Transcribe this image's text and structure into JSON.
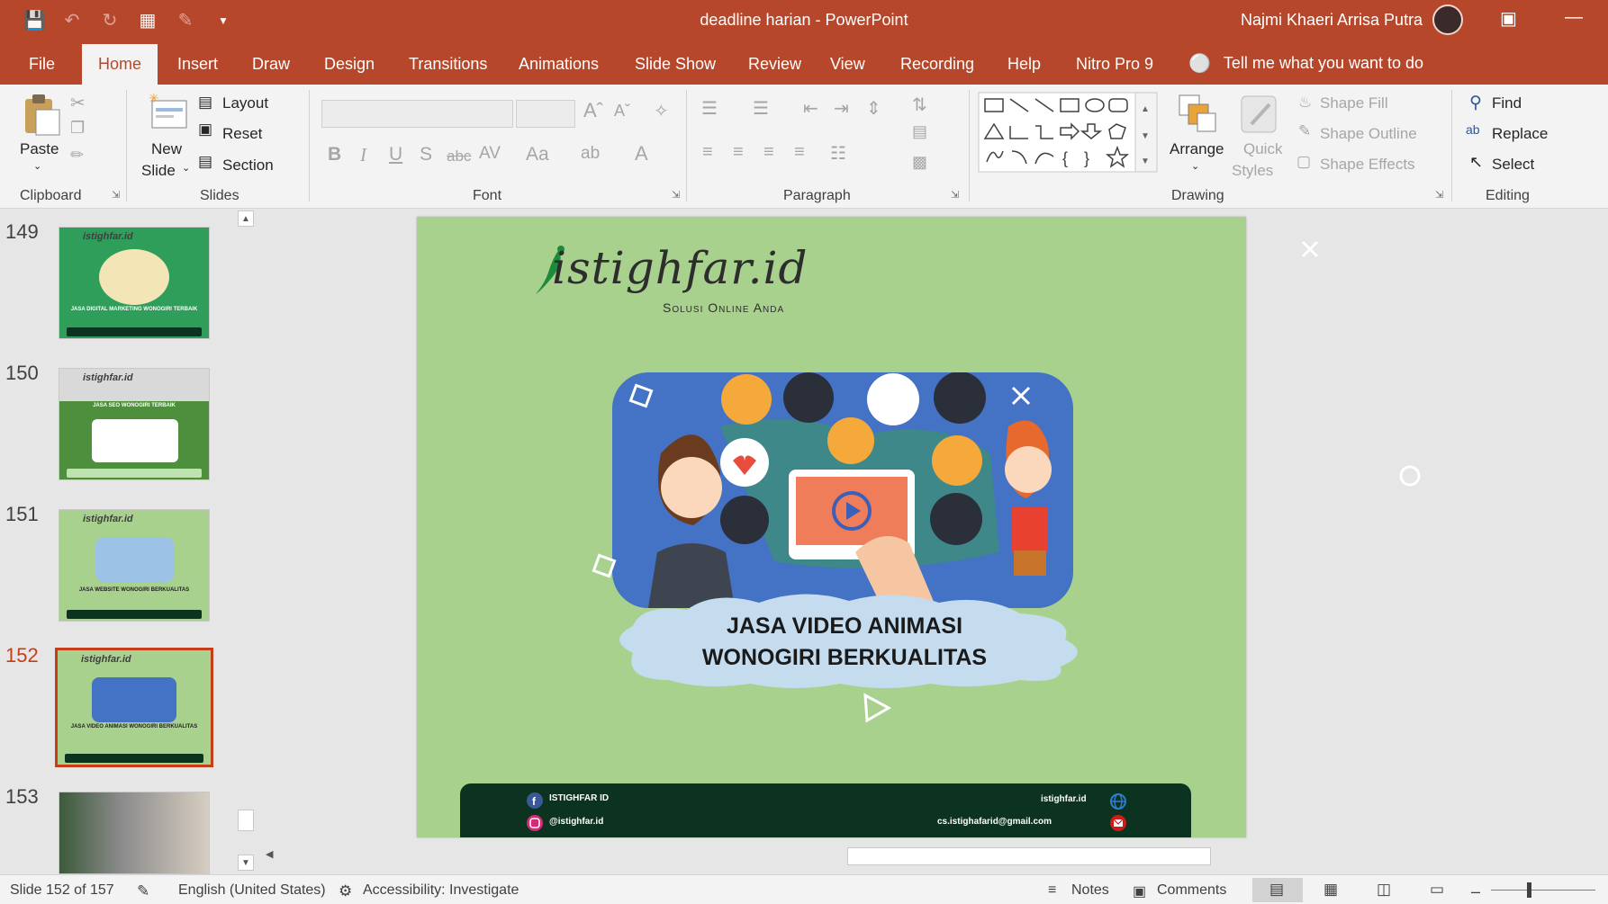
{
  "titlebar": {
    "doc_name": "deadline harian",
    "app_name": "PowerPoint",
    "title": "deadline harian  -  PowerPoint",
    "user_name": "Najmi Khaeri Arrisa Putra"
  },
  "tabs": [
    {
      "label": "File"
    },
    {
      "label": "Home"
    },
    {
      "label": "Insert"
    },
    {
      "label": "Draw"
    },
    {
      "label": "Design"
    },
    {
      "label": "Transitions"
    },
    {
      "label": "Animations"
    },
    {
      "label": "Slide Show"
    },
    {
      "label": "Review"
    },
    {
      "label": "View"
    },
    {
      "label": "Recording"
    },
    {
      "label": "Help"
    },
    {
      "label": "Nitro Pro 9"
    }
  ],
  "active_tab": "Home",
  "tell_me": "Tell me what you want to do",
  "ribbon": {
    "clipboard": {
      "label": "Clipboard",
      "paste": "Paste"
    },
    "slides": {
      "label": "Slides",
      "new_slide_1": "New",
      "new_slide_2": "Slide",
      "layout": "Layout",
      "reset": "Reset",
      "section": "Section"
    },
    "font": {
      "label": "Font"
    },
    "paragraph": {
      "label": "Paragraph"
    },
    "drawing": {
      "label": "Drawing",
      "arrange": "Arrange",
      "quick_styles_1": "Quick",
      "quick_styles_2": "Styles",
      "shape_fill": "Shape Fill",
      "shape_outline": "Shape Outline",
      "shape_effects": "Shape Effects"
    },
    "editing": {
      "label": "Editing",
      "find": "Find",
      "replace": "Replace",
      "select": "Select"
    }
  },
  "thumbnails": [
    {
      "number": "149",
      "caption": "JASA DIGITAL MARKETING WONOGIRI TERBAIK"
    },
    {
      "number": "150",
      "caption": "JASA SEO WONOGIRI TERBAIK"
    },
    {
      "number": "151",
      "caption": "JASA WEBSITE WONOGIRI BERKUALITAS"
    },
    {
      "number": "152",
      "caption": "JASA VIDEO ANIMASI WONOGIRI BERKUALITAS"
    },
    {
      "number": "153",
      "caption": ""
    }
  ],
  "active_slide": "152",
  "slide": {
    "logo": "istighfar.id",
    "tagline": "Solusi Online  Anda",
    "caption_line1": "JASA VIDEO ANIMASI",
    "caption_line2": "WONOGIRI BERKUALITAS",
    "footer": {
      "facebook": "ISTIGHFAR ID",
      "instagram": "@istighfar.id",
      "website": "istighfar.id",
      "email": "cs.istighafarid@gmail.com"
    }
  },
  "status": {
    "slide_info": "Slide 152 of 157",
    "language": "English (United States)",
    "accessibility": "Accessibility: Investigate",
    "notes": "Notes",
    "comments": "Comments"
  },
  "colors": {
    "accent": "#b7472a",
    "slide_bg": "#a9d18e",
    "hero_bg": "#4472c4",
    "footer_bg": "#0b3320",
    "active_thumb": "#c43e1c"
  }
}
